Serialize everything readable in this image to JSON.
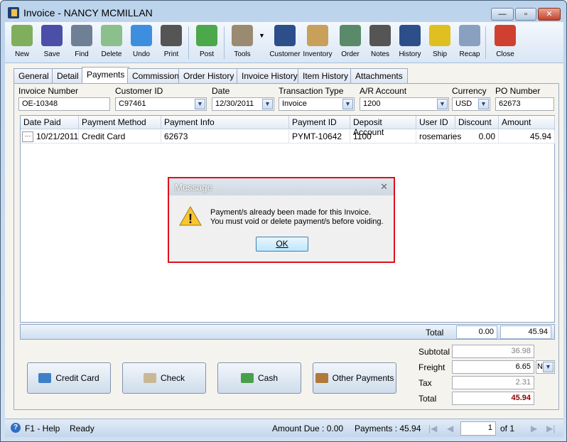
{
  "window": {
    "title": "Invoice - NANCY MCMILLAN"
  },
  "toolbar": [
    {
      "label": "New",
      "icon": "new-document-icon"
    },
    {
      "label": "Save",
      "icon": "floppy-disk-icon"
    },
    {
      "label": "Find",
      "icon": "binoculars-icon"
    },
    {
      "label": "Delete",
      "icon": "recycle-bin-icon"
    },
    {
      "label": "Undo",
      "icon": "undo-arrow-icon"
    },
    {
      "label": "Print",
      "icon": "printer-icon"
    },
    {
      "label": "Post",
      "icon": "post-checkmark-icon"
    },
    {
      "label": "Tools",
      "icon": "tools-icon"
    },
    {
      "label": "Customer",
      "icon": "customer-person-icon"
    },
    {
      "label": "Inventory",
      "icon": "boxes-icon"
    },
    {
      "label": "Order",
      "icon": "handheld-device-icon"
    },
    {
      "label": "Notes",
      "icon": "notepad-pen-icon"
    },
    {
      "label": "History",
      "icon": "person-hourglass-icon"
    },
    {
      "label": "Ship",
      "icon": "forklift-icon"
    },
    {
      "label": "Recap",
      "icon": "recap-document-icon"
    },
    {
      "label": "Close",
      "icon": "close-window-icon"
    }
  ],
  "tabs": [
    "General",
    "Detail",
    "Payments",
    "Commission",
    "Order History",
    "Invoice History",
    "Item History",
    "Attachments"
  ],
  "active_tab": "Payments",
  "form": {
    "invoice_number": {
      "label": "Invoice Number",
      "value": "OE-10348"
    },
    "customer_id": {
      "label": "Customer ID",
      "value": "C97461"
    },
    "date": {
      "label": "Date",
      "value": "12/30/2011"
    },
    "transaction_type": {
      "label": "Transaction Type",
      "value": "Invoice"
    },
    "ar_account": {
      "label": "A/R Account",
      "value": "1200"
    },
    "currency": {
      "label": "Currency",
      "value": "USD"
    },
    "po_number": {
      "label": "PO Number",
      "value": "62673"
    }
  },
  "grid": {
    "columns": [
      "Date Paid",
      "Payment Method",
      "Payment Info",
      "Payment ID",
      "Deposit Account",
      "User ID",
      "Discount",
      "Amount"
    ],
    "rows": [
      [
        "10/21/2011",
        "Credit Card",
        "62673",
        "PYMT-10642",
        "1100",
        "rosemaries",
        "0.00",
        "45.94"
      ]
    ],
    "total_label": "Total",
    "total_discount": "0.00",
    "total_amount": "45.94"
  },
  "payment_buttons": [
    {
      "label": "Credit Card",
      "icon": "credit-card-icon"
    },
    {
      "label": "Check",
      "icon": "check-icon"
    },
    {
      "label": "Cash",
      "icon": "cash-icon"
    },
    {
      "label": "Other Payments",
      "icon": "other-payments-icon"
    }
  ],
  "totals": {
    "subtotal_label": "Subtotal",
    "subtotal": "36.98",
    "freight_label": "Freight",
    "freight": "6.65",
    "freight_option": "N",
    "tax_label": "Tax",
    "tax": "2.31",
    "total_label": "Total",
    "total": "45.94"
  },
  "status": {
    "help": "F1 - Help",
    "state": "Ready",
    "amount_due": "Amount Due : 0.00",
    "payments": "Payments : 45.94",
    "page": "1",
    "of": "of 1"
  },
  "dialog": {
    "title": "Message",
    "line1": "Payment/s already been made for this Invoice.",
    "line2": "You must void or delete payment/s before voiding.",
    "ok": "OK"
  },
  "colors": {
    "total_highlight": "#8b0000",
    "dialog_border": "#e0101a"
  }
}
